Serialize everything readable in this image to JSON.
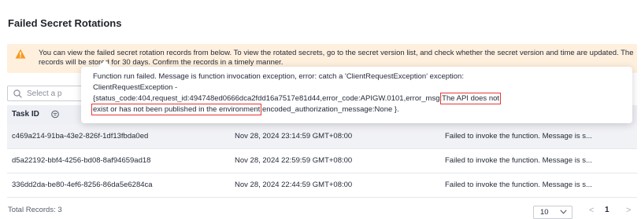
{
  "page": {
    "title": "Failed Secret Rotations"
  },
  "notice": {
    "icon": "warning-triangle-icon",
    "text": "You can view the failed secret rotation records from below. To view the rotated secrets, go to the secret version list, and check whether the secret version and time are updated. The records will be stored for 30 days. Confirm the records in a timely manner."
  },
  "search": {
    "placeholder": "Select a p"
  },
  "table": {
    "columns": {
      "task_id": "Task ID"
    },
    "rows": [
      {
        "task_id": "c469a214-91ba-43e2-826f-1df13fbda0ed",
        "time": "Nov 28, 2024 23:14:59 GMT+08:00",
        "message": "Failed to invoke the function. Message is s..."
      },
      {
        "task_id": "d5a22192-bbf4-4256-bd08-8af94659ad18",
        "time": "Nov 28, 2024 22:59:59 GMT+08:00",
        "message": "Failed to invoke the function. Message is s..."
      },
      {
        "task_id": "336dd2da-be80-4ef6-8256-86da5e6284ca",
        "time": "Nov 28, 2024 22:44:59 GMT+08:00",
        "message": "Failed to invoke the function. Message is s..."
      }
    ]
  },
  "tooltip": {
    "line1": "Function run failed. Message is function invocation exception, error: catch a 'ClientRequestException' exception:",
    "line2": "ClientRequestException -",
    "line3_prefix": "{status_code:404,request_id:494748ed0666dca2fdd16a7517e81d44,error_code:APIGW.0101,error_msg:",
    "line3_highlight": "The API does not",
    "line4_highlight": "exist or has not been published in the environment",
    "line4_suffix": ",encoded_authorization_message:None }."
  },
  "footer": {
    "total_records": "Total Records: 3",
    "page_size": "10",
    "current_page": "1",
    "prev": "<",
    "next": ">"
  },
  "colors": {
    "highlight": "#e53935",
    "notice_bg": "#fff0de",
    "warning": "#f59a23"
  }
}
